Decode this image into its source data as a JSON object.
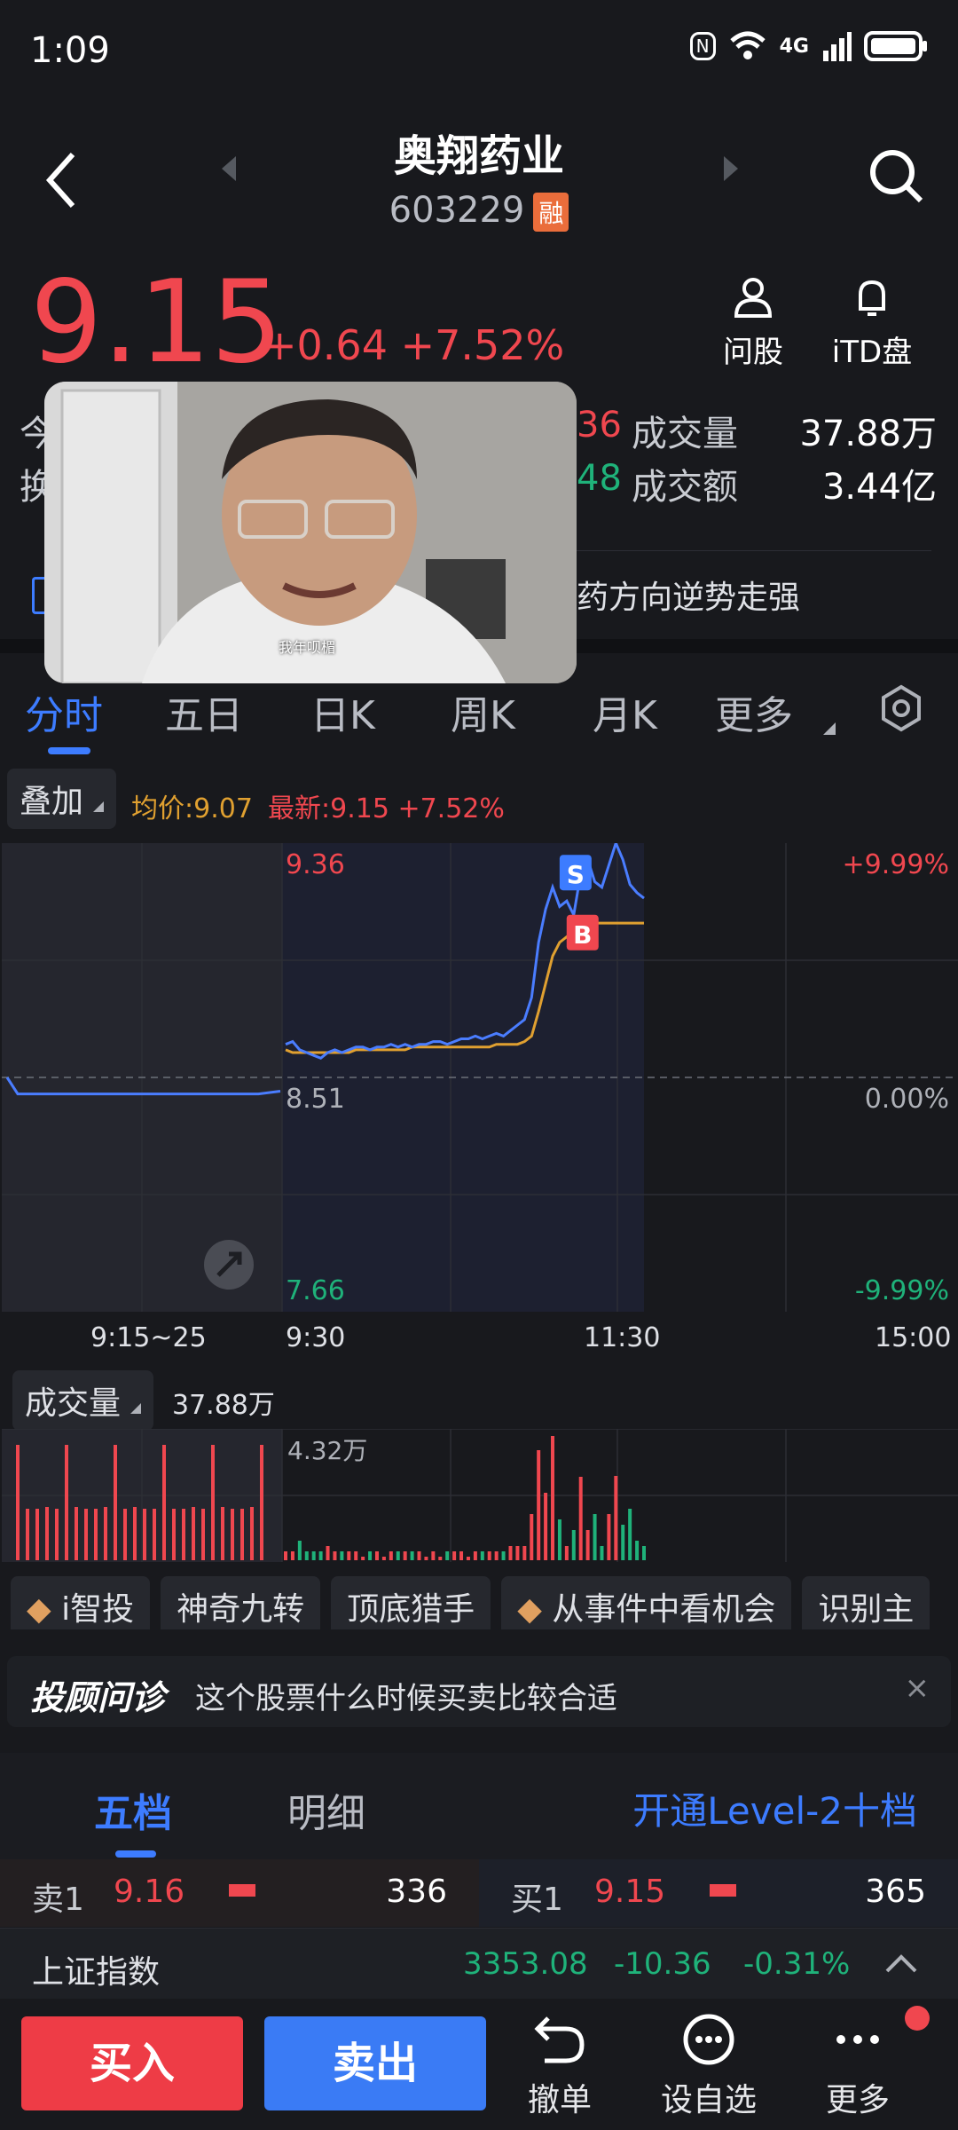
{
  "status": {
    "time": "1:09",
    "network": "4G"
  },
  "header": {
    "title": "奥翔药业",
    "code": "603229",
    "badge": "融"
  },
  "quote": {
    "price": "9.15",
    "change": "+0.64",
    "change_pct": "+7.52%"
  },
  "header_actions": [
    {
      "label": "问股",
      "icon": "user-icon"
    },
    {
      "label": "iTD盘",
      "icon": "bell-icon"
    }
  ],
  "stats": {
    "partial_1": "36",
    "volume_label": "成交量",
    "volume": "37.88万",
    "partial_2": "48",
    "amount_label": "成交额",
    "amount": "3.44亿",
    "left_chars": [
      "今",
      "换"
    ]
  },
  "news": {
    "text": "药方向逆势走强"
  },
  "video": {
    "caption": "我年呗楣"
  },
  "tabs": {
    "items": [
      "分时",
      "五日",
      "日K",
      "周K",
      "月K",
      "更多"
    ]
  },
  "overlay": {
    "label": "叠加",
    "avg_label": "均价:9.07",
    "latest_label": "最新:9.15 +7.52%"
  },
  "chart_data": {
    "type": "line",
    "title": "",
    "y_labels": {
      "top": "9.36",
      "mid": "8.51",
      "bottom": "7.66",
      "top_pct": "+9.99%",
      "mid_pct": "0.00%",
      "bottom_pct": "-9.99%"
    },
    "x_labels": [
      "9:15~25",
      "9:30",
      "11:30",
      "15:00"
    ],
    "ylim": [
      7.66,
      9.36
    ],
    "prev_close": 8.51,
    "pre_auction": [
      8.51,
      8.45,
      8.45,
      8.45,
      8.45,
      8.45,
      8.45,
      8.45,
      8.45,
      8.45,
      8.45,
      8.45,
      8.45,
      8.46
    ],
    "price": [
      8.63,
      8.64,
      8.61,
      8.6,
      8.59,
      8.58,
      8.6,
      8.61,
      8.6,
      8.61,
      8.62,
      8.62,
      8.61,
      8.62,
      8.62,
      8.63,
      8.62,
      8.63,
      8.62,
      8.63,
      8.63,
      8.64,
      8.64,
      8.63,
      8.64,
      8.65,
      8.65,
      8.66,
      8.65,
      8.66,
      8.67,
      8.66,
      8.68,
      8.7,
      8.72,
      8.8,
      9.0,
      9.12,
      9.2,
      9.13,
      9.15,
      9.1,
      9.25,
      9.3,
      9.22,
      9.2,
      9.28,
      9.36,
      9.3,
      9.21,
      9.18,
      9.16
    ],
    "avg": [
      8.61,
      8.6,
      8.6,
      8.6,
      8.6,
      8.6,
      8.6,
      8.6,
      8.6,
      8.6,
      8.61,
      8.61,
      8.61,
      8.61,
      8.61,
      8.61,
      8.61,
      8.61,
      8.62,
      8.62,
      8.62,
      8.62,
      8.62,
      8.62,
      8.62,
      8.62,
      8.62,
      8.62,
      8.62,
      8.62,
      8.63,
      8.63,
      8.63,
      8.63,
      8.64,
      8.66,
      8.75,
      8.85,
      8.95,
      9.0,
      9.02,
      9.04,
      9.05,
      9.06,
      9.07,
      9.07,
      9.07,
      9.07,
      9.07,
      9.07,
      9.07,
      9.07
    ],
    "trade_marks": [
      {
        "label": "S",
        "color": "#3d7cff"
      },
      {
        "label": "B",
        "color": "#f0474f"
      },
      {
        "label": "S",
        "color": "#3d7cff"
      }
    ],
    "volume": {
      "label": "成交量",
      "total": "37.88万",
      "max_label": "4.32万"
    }
  },
  "tools": [
    "i智投",
    "神奇九转",
    "顶底猎手",
    "从事件中看机会",
    "识别主"
  ],
  "advisor": {
    "brand": "投顾问诊",
    "text": "这个股票什么时候买卖比较合适"
  },
  "order_tabs": {
    "items": [
      "五档",
      "明细"
    ],
    "level2": "开通Level-2十档"
  },
  "order": {
    "sell_label": "卖1",
    "sell_price": "9.16",
    "sell_vol": "336",
    "buy_label": "买1",
    "buy_price": "9.15",
    "buy_vol": "365"
  },
  "index_bar": {
    "name": "上证指数",
    "value": "3353.08",
    "change": "-10.36",
    "pct": "-0.31%"
  },
  "actions": {
    "buy": "买入",
    "sell": "卖出",
    "cancel": "撤单",
    "watch": "设自选",
    "more": "更多"
  },
  "colors": {
    "up": "#f0474f",
    "down": "#1fb27a",
    "accent": "#3d7cff",
    "avg": "#e0a030"
  }
}
